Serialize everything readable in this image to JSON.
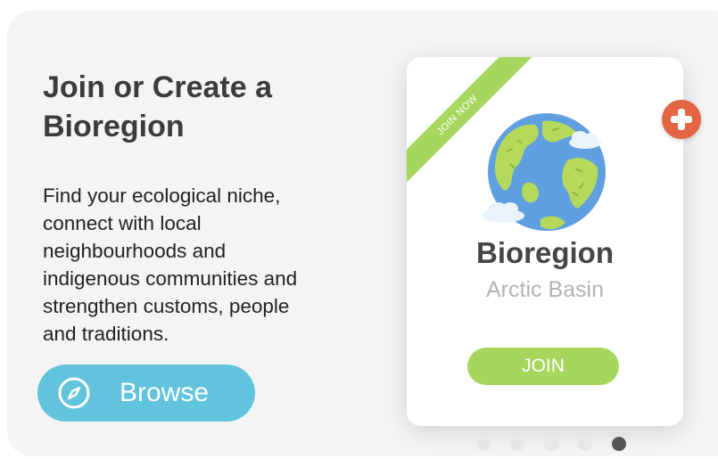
{
  "intro": {
    "title": "Join or Create a Bioregion",
    "description": "Find your ecological niche, connect with local neighbourhoods and indigenous communities and strengthen customs, people and traditions.",
    "browse_label": "Browse",
    "browse_icon": "compass-icon"
  },
  "card": {
    "ribbon": "JOIN NOW",
    "title": "Bioregion",
    "subtitle": "Arctic Basin",
    "join_label": "JOIN",
    "image_icon": "globe-icon",
    "add_icon": "plus-icon"
  },
  "carousel": {
    "count": 5,
    "active_index": 4
  },
  "colors": {
    "browse": "#62c3dd",
    "accent_green": "#a6d65e",
    "add_button": "#e46543",
    "ocean": "#5f9fe0",
    "land": "#b5d95a"
  }
}
